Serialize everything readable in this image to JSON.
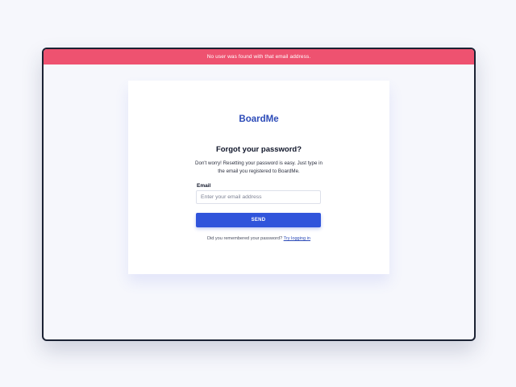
{
  "banner": {
    "message": "No user was found with that email address."
  },
  "brand": {
    "name": "BoardMe"
  },
  "form": {
    "heading": "Forgot your password?",
    "description": "Don't worry! Resetting your password is easy. Just type in the email you registered to BoardMe.",
    "email_label": "Email",
    "email_placeholder": "Enter your email address",
    "email_value": "",
    "submit_label": "SEND",
    "remember_text": "Did you remembered your password?",
    "login_link": "Try logging in"
  },
  "colors": {
    "error_banner": "#ee5270",
    "brand": "#2c4bb8",
    "primary_button": "#3054db",
    "background": "#f6f7fc"
  }
}
